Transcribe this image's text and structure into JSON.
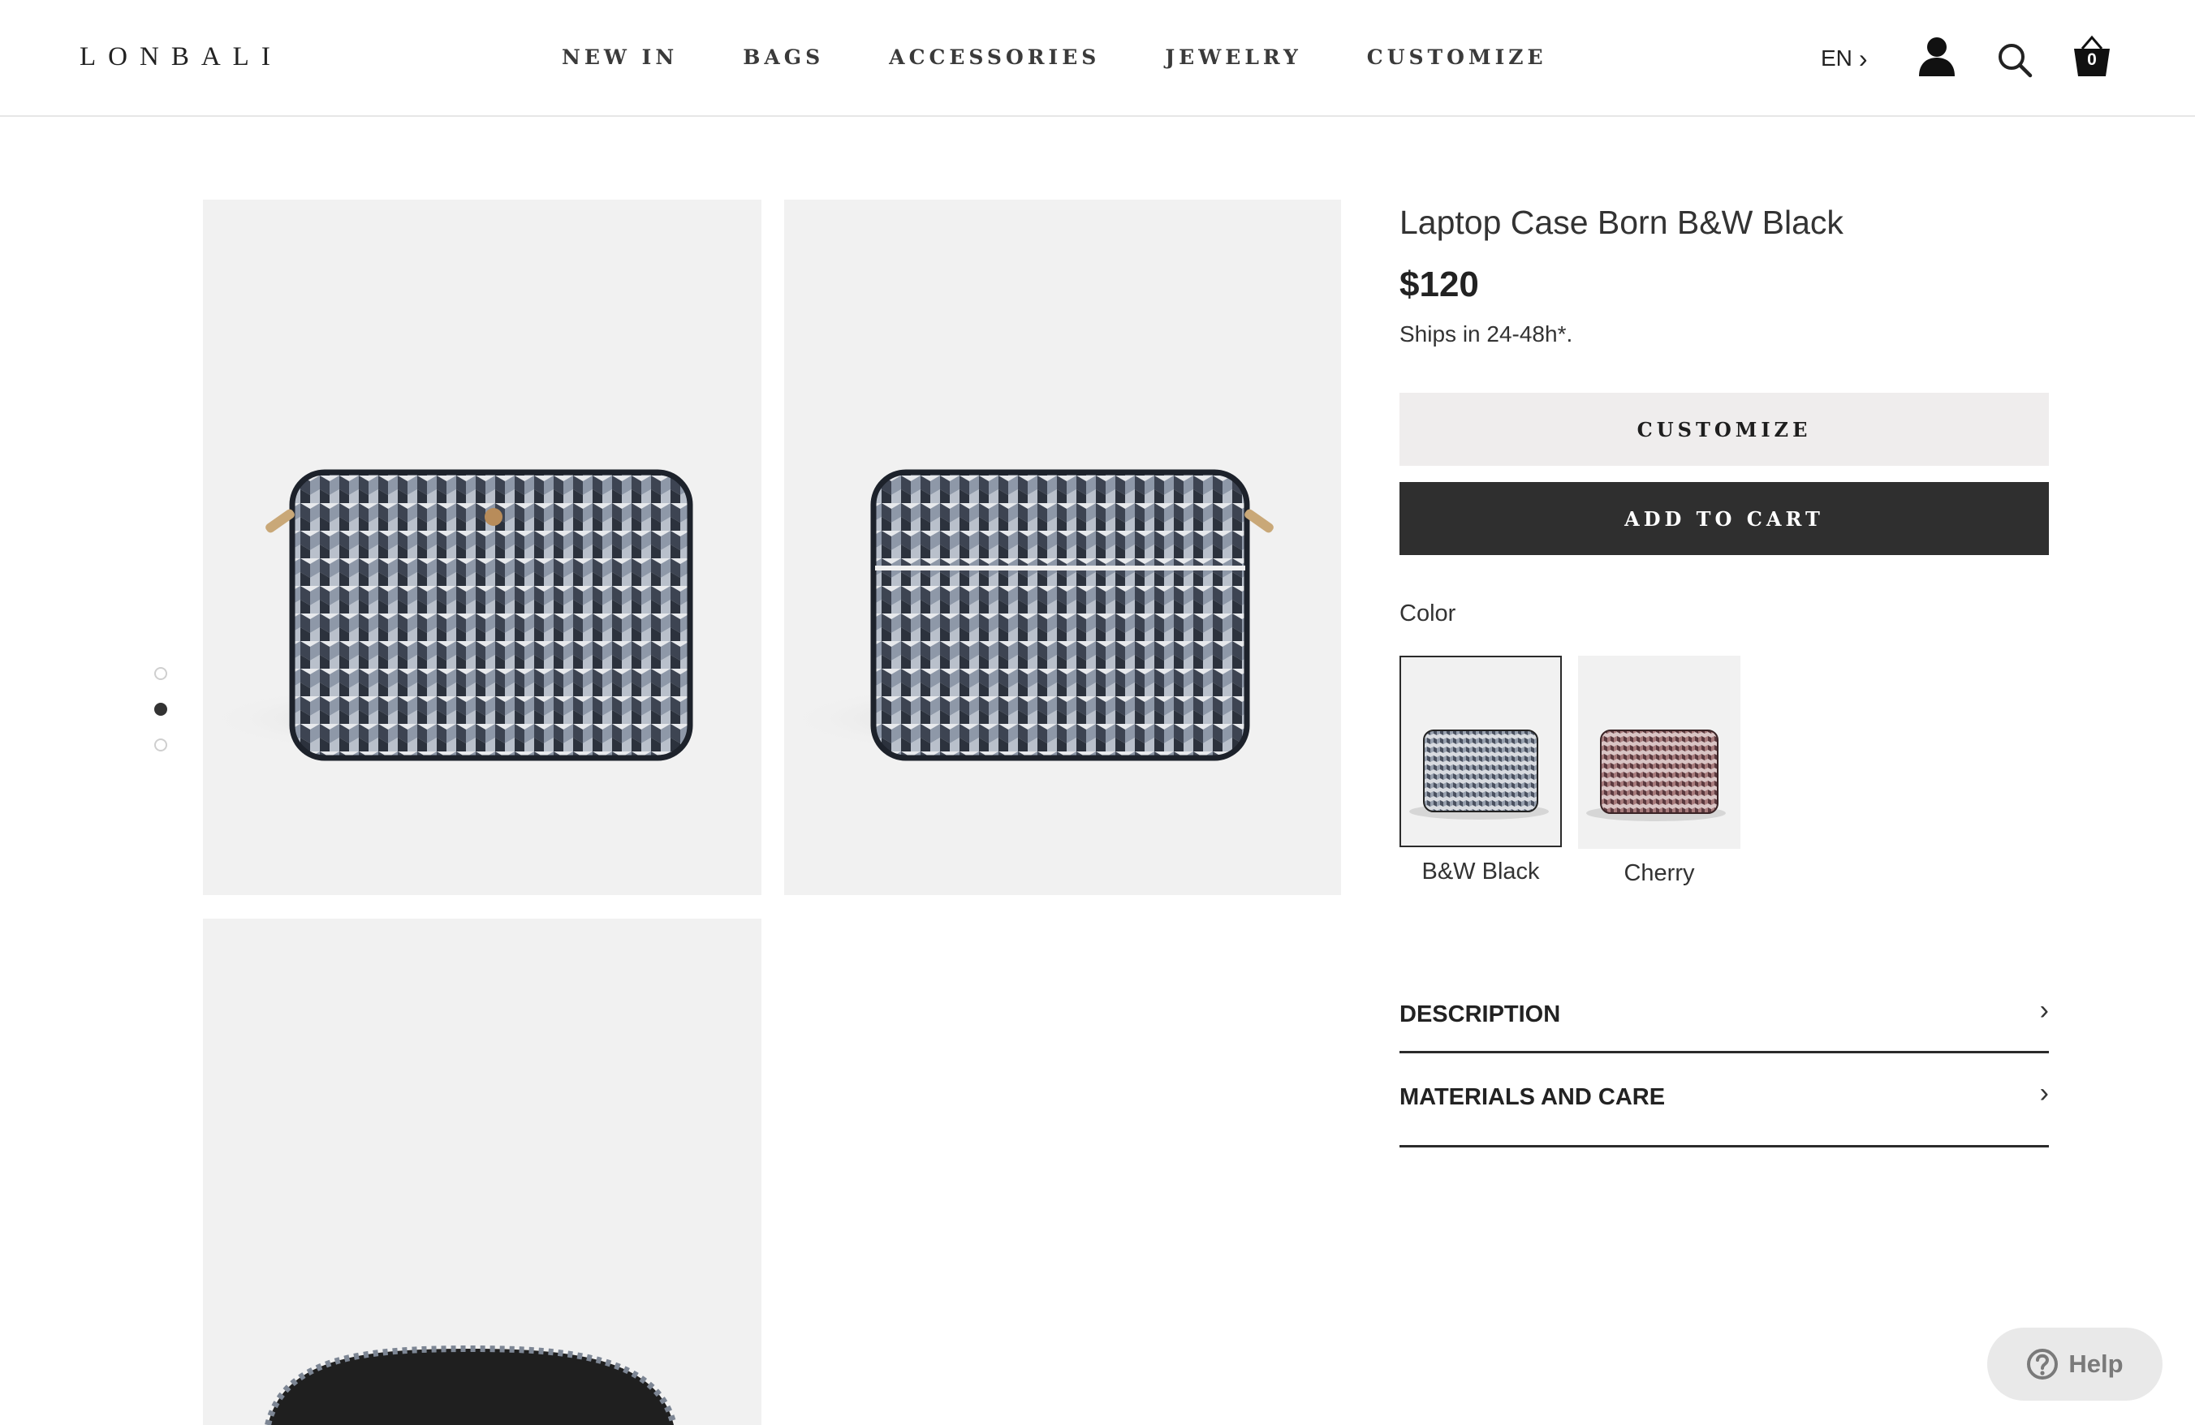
{
  "brand": {
    "logo": "LONBALI"
  },
  "nav": {
    "items": [
      "NEW IN",
      "BAGS",
      "ACCESSORIES",
      "JEWELRY",
      "CUSTOMIZE"
    ],
    "language": "EN",
    "cart_count": "0"
  },
  "gallery": {
    "image_count": 3,
    "active_dot_index": 1
  },
  "product": {
    "title": "Laptop Case Born B&W Black",
    "price": "$120",
    "shipping": "Ships in 24-48h*.",
    "customize_label": "CUSTOMIZE",
    "add_to_cart_label": "ADD TO CART",
    "color_label": "Color",
    "colors": [
      {
        "name": "B&W Black",
        "selected": true,
        "swatch": "#8a919c"
      },
      {
        "name": "Cherry",
        "selected": false,
        "swatch": "#8b5a5c"
      }
    ]
  },
  "accordions": [
    "DESCRIPTION",
    "MATERIALS AND CARE"
  ],
  "help": {
    "label": "Help"
  }
}
